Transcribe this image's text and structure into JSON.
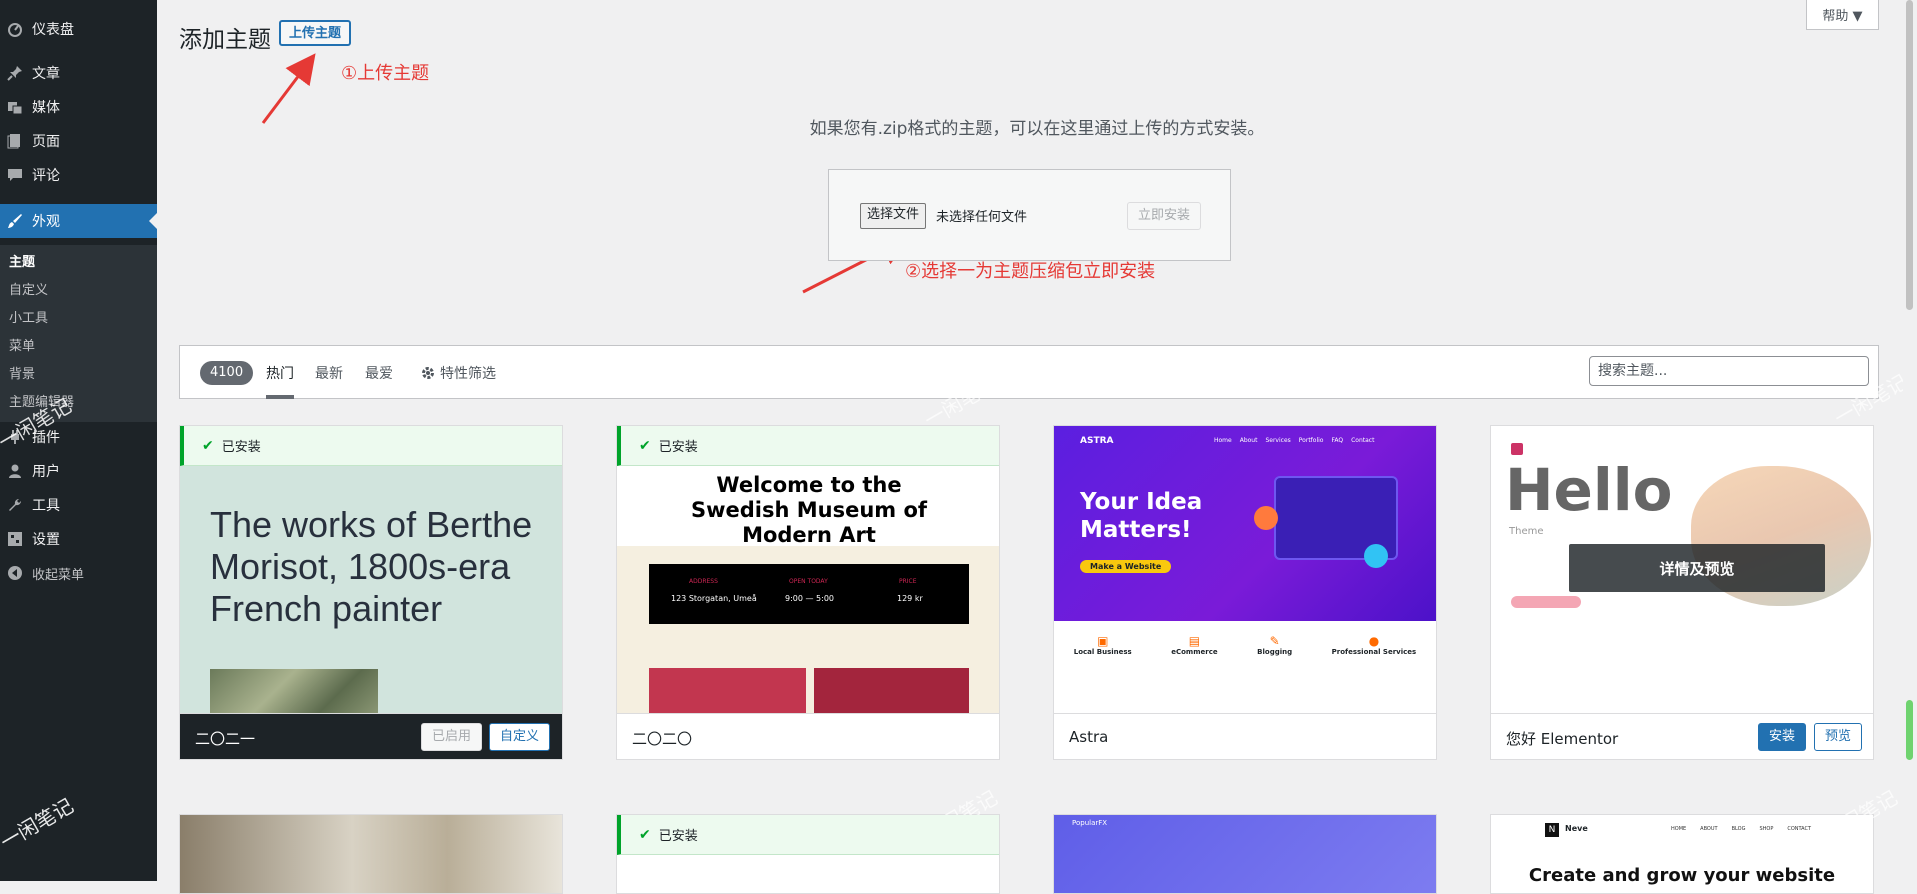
{
  "sidebar": {
    "items": [
      {
        "label": "仪表盘",
        "icon": "dashboard-icon"
      },
      {
        "label": "文章",
        "icon": "pin-icon"
      },
      {
        "label": "媒体",
        "icon": "media-icon"
      },
      {
        "label": "页面",
        "icon": "page-icon"
      },
      {
        "label": "评论",
        "icon": "comment-icon"
      },
      {
        "label": "外观",
        "icon": "brush-icon"
      },
      {
        "label": "插件",
        "icon": "plugin-icon"
      },
      {
        "label": "用户",
        "icon": "user-icon"
      },
      {
        "label": "工具",
        "icon": "wrench-icon"
      },
      {
        "label": "设置",
        "icon": "settings-icon"
      },
      {
        "label": "收起菜单",
        "icon": "collapse-icon"
      }
    ],
    "submenu": [
      "主题",
      "自定义",
      "小工具",
      "菜单",
      "背景",
      "主题编辑器"
    ]
  },
  "header": {
    "title": "添加主题",
    "upload_button": "上传主题",
    "help_button": "帮助 ▼"
  },
  "annotations": {
    "step1": "①上传主题",
    "step2": "②选择一为主题压缩包立即安装"
  },
  "upload": {
    "description": "如果您有.zip格式的主题，可以在这里通过上传的方式安装。",
    "choose_file": "选择文件",
    "no_file": "未选择任何文件",
    "install_now": "立即安装"
  },
  "filter": {
    "count": "4100",
    "tabs": [
      "热门",
      "最新",
      "最爱"
    ],
    "feature_filter": "特性筛选",
    "search_placeholder": "搜索主题..."
  },
  "themes": [
    {
      "name": "二〇二一",
      "installed": "已安装",
      "buttons": [
        "已启用",
        "自定义"
      ],
      "screenshot_text": "The works of Berthe Morisot, 1800s-era French painter"
    },
    {
      "name": "二〇二〇",
      "installed": "已安装",
      "screenshot_text": "Welcome to the Swedish Museum of Modern Art",
      "table": {
        "headers": [
          "ADDRESS",
          "OPEN TODAY",
          "PRICE"
        ],
        "values": [
          "123 Storgatan, Umeå",
          "9:00 — 5:00",
          "129 kr"
        ]
      }
    },
    {
      "name": "Astra",
      "screenshot_text": "Your Idea Matters!",
      "cta": "Make a Website",
      "logo": "ASTRA",
      "nav": [
        "Home",
        "About",
        "Services",
        "Portfolio",
        "FAQ",
        "Contact"
      ],
      "services": [
        "Local Business",
        "eCommerce",
        "Blogging",
        "Professional Services"
      ]
    },
    {
      "name": "您好 Elementor",
      "screenshot_text": "Hello",
      "sub_text": "Theme",
      "overlay": "详情及预览",
      "buttons": [
        "安装",
        "预览"
      ]
    }
  ],
  "second_row": [
    {
      "installed": ""
    },
    {
      "installed": "已安装"
    },
    {
      "logo": "PopularFX"
    },
    {
      "logo": "Neve",
      "headline": "Create and grow your website",
      "nav": [
        "HOME",
        "ABOUT",
        "BLOG",
        "SHOP",
        "CONTACT"
      ]
    }
  ],
  "watermark": "一闲笔记",
  "colors": {
    "admin_dark": "#1d2327",
    "accent": "#2271b1",
    "installed_green": "#00a32a",
    "annotation_red": "#e53935"
  }
}
